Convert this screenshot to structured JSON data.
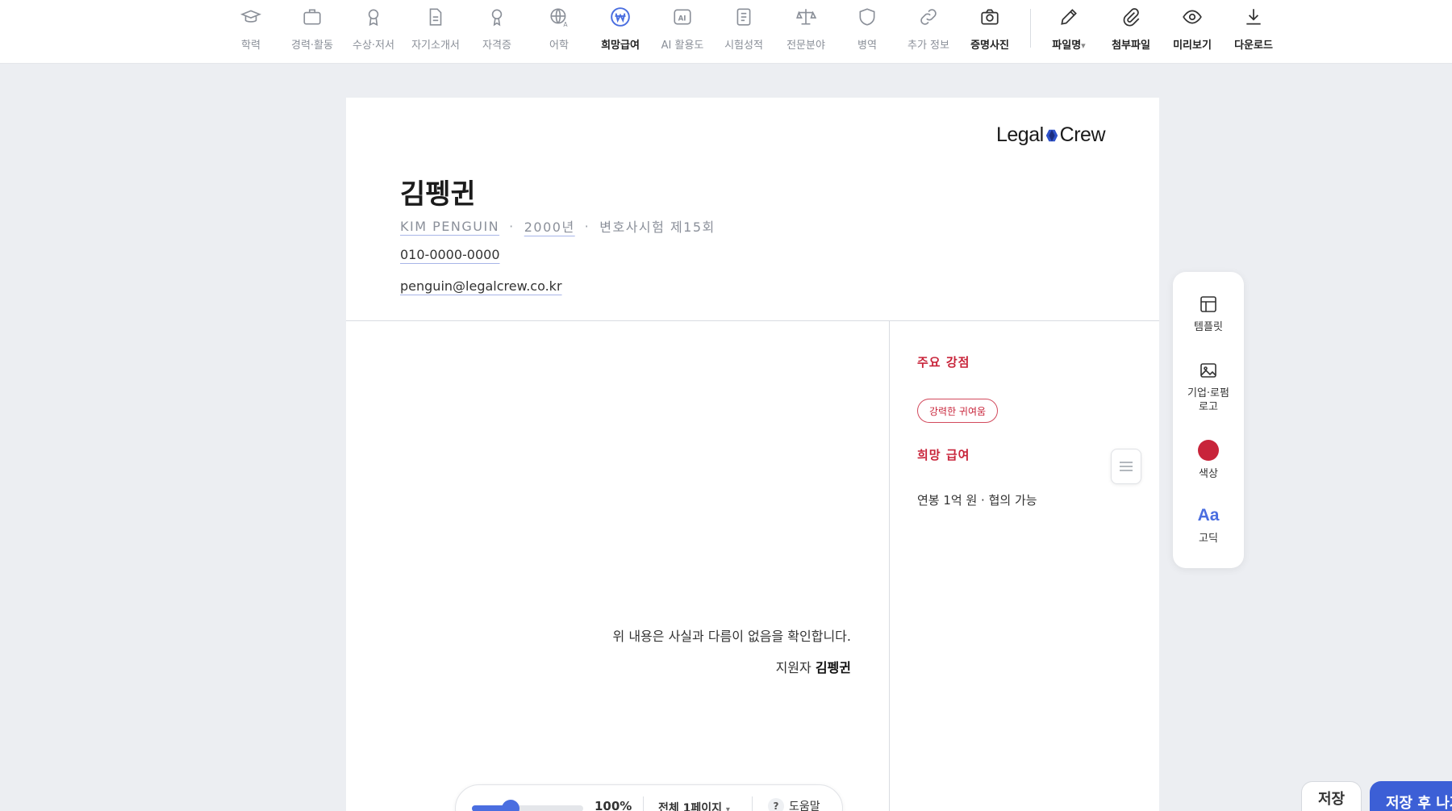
{
  "toolbar": {
    "items": [
      {
        "label": "학력",
        "icon": "graduation-cap-icon"
      },
      {
        "label": "경력·활동",
        "icon": "briefcase-icon"
      },
      {
        "label": "수상·저서",
        "icon": "award-icon"
      },
      {
        "label": "자기소개서",
        "icon": "document-icon"
      },
      {
        "label": "자격증",
        "icon": "badge-icon"
      },
      {
        "label": "어학",
        "icon": "globe-language-icon"
      },
      {
        "label": "희망급여",
        "icon": "won-coin-icon"
      },
      {
        "label": "AI 활용도",
        "icon": "ai-icon"
      },
      {
        "label": "시험성적",
        "icon": "report-icon"
      },
      {
        "label": "전문분야",
        "icon": "scales-icon"
      },
      {
        "label": "병역",
        "icon": "shield-icon"
      },
      {
        "label": "추가 정보",
        "icon": "link-icon"
      },
      {
        "label": "증명사진",
        "icon": "camera-icon"
      },
      {
        "label": "파일명",
        "icon": "pencil-icon"
      },
      {
        "label": "첨부파일",
        "icon": "paperclip-icon"
      },
      {
        "label": "미리보기",
        "icon": "eye-icon"
      },
      {
        "label": "다운로드",
        "icon": "download-icon"
      }
    ],
    "active_item": "희망급여",
    "dropdown_arrow": "▾"
  },
  "resume": {
    "logo_left": "Legal",
    "logo_right": "Crew",
    "name": "김펭귄",
    "english_name": "KIM PENGUIN",
    "birth_year": "2000년",
    "exam": "변호사시험 제15회",
    "separator": "·",
    "phone": "010-0000-0000",
    "email": "penguin@legalcrew.co.kr",
    "strengths_title": "주요 강점",
    "strength_chip": "강력한 귀여움",
    "salary_title": "희망 급여",
    "salary_text": "연봉 1억 원 · 협의 가능",
    "confirmation": "위 내용은 사실과 다름이 없음을 확인합니다.",
    "signer_prefix": "지원자",
    "signer_name": "김펭귄"
  },
  "side_panel": {
    "template_label": "템플릿",
    "logo_label_line1": "기업·로펌",
    "logo_label_line2": "로고",
    "color_label": "색상",
    "color_value": "#c8243a",
    "font_sample": "Aa",
    "font_label": "고딕"
  },
  "bottom_bar": {
    "zoom": "100%",
    "zoom_fraction": 0.35,
    "page_select": "전체 1페이지",
    "help_label": "도움말",
    "help_icon": "?"
  },
  "actions": {
    "save": "저장",
    "save_next": "저장 후 나가기"
  },
  "colors": {
    "accent": "#4a6ee0",
    "brand_red": "#c8243a",
    "primary_button": "#3c5fd6"
  }
}
